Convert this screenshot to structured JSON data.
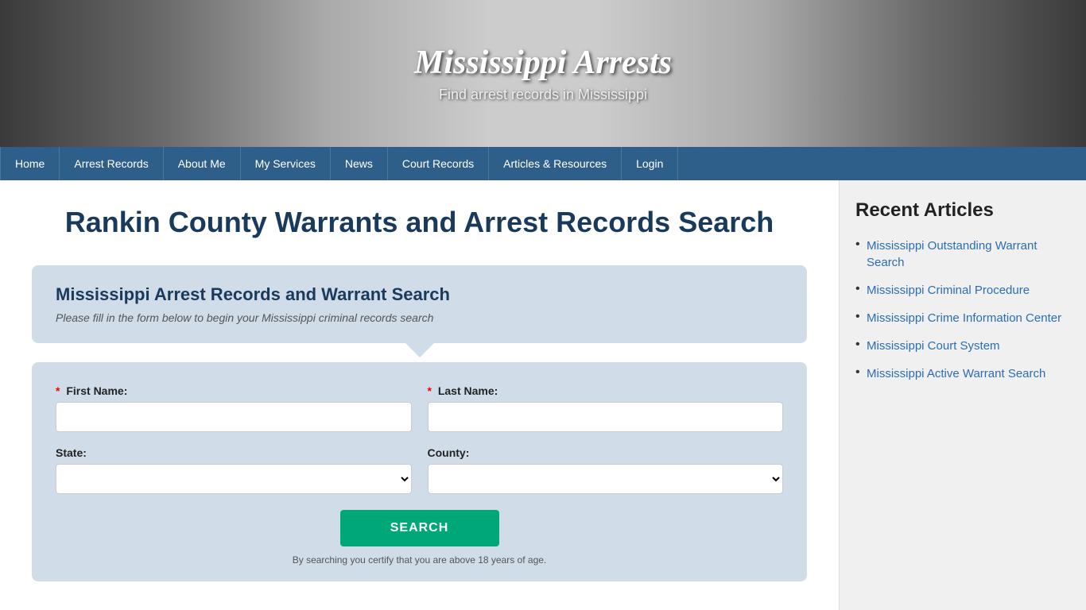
{
  "site": {
    "title": "Mississippi Arrests",
    "subtitle": "Find arrest records in Mississippi"
  },
  "nav": {
    "items": [
      {
        "label": "Home",
        "href": "#"
      },
      {
        "label": "Arrest Records",
        "href": "#"
      },
      {
        "label": "About Me",
        "href": "#"
      },
      {
        "label": "My Services",
        "href": "#"
      },
      {
        "label": "News",
        "href": "#"
      },
      {
        "label": "Court Records",
        "href": "#"
      },
      {
        "label": "Articles & Resources",
        "href": "#"
      },
      {
        "label": "Login",
        "href": "#"
      }
    ]
  },
  "main": {
    "page_title": "Rankin County Warrants and Arrest Records Search",
    "form_box": {
      "title": "Mississippi Arrest Records and Warrant Search",
      "subtitle": "Please fill in the form below to begin your Mississippi criminal records search"
    },
    "form": {
      "first_name_label": "First Name:",
      "last_name_label": "Last Name:",
      "state_label": "State:",
      "county_label": "County:",
      "search_button": "SEARCH",
      "disclaimer": "By searching you certify that you are above 18 years of age."
    }
  },
  "sidebar": {
    "title": "Recent Articles",
    "articles": [
      {
        "label": "Mississippi Outstanding Warrant Search",
        "href": "#"
      },
      {
        "label": "Mississippi Criminal Procedure",
        "href": "#"
      },
      {
        "label": "Mississippi Crime Information Center",
        "href": "#"
      },
      {
        "label": "Mississippi Court System",
        "href": "#"
      },
      {
        "label": "Mississippi Active Warrant Search",
        "href": "#"
      }
    ]
  }
}
